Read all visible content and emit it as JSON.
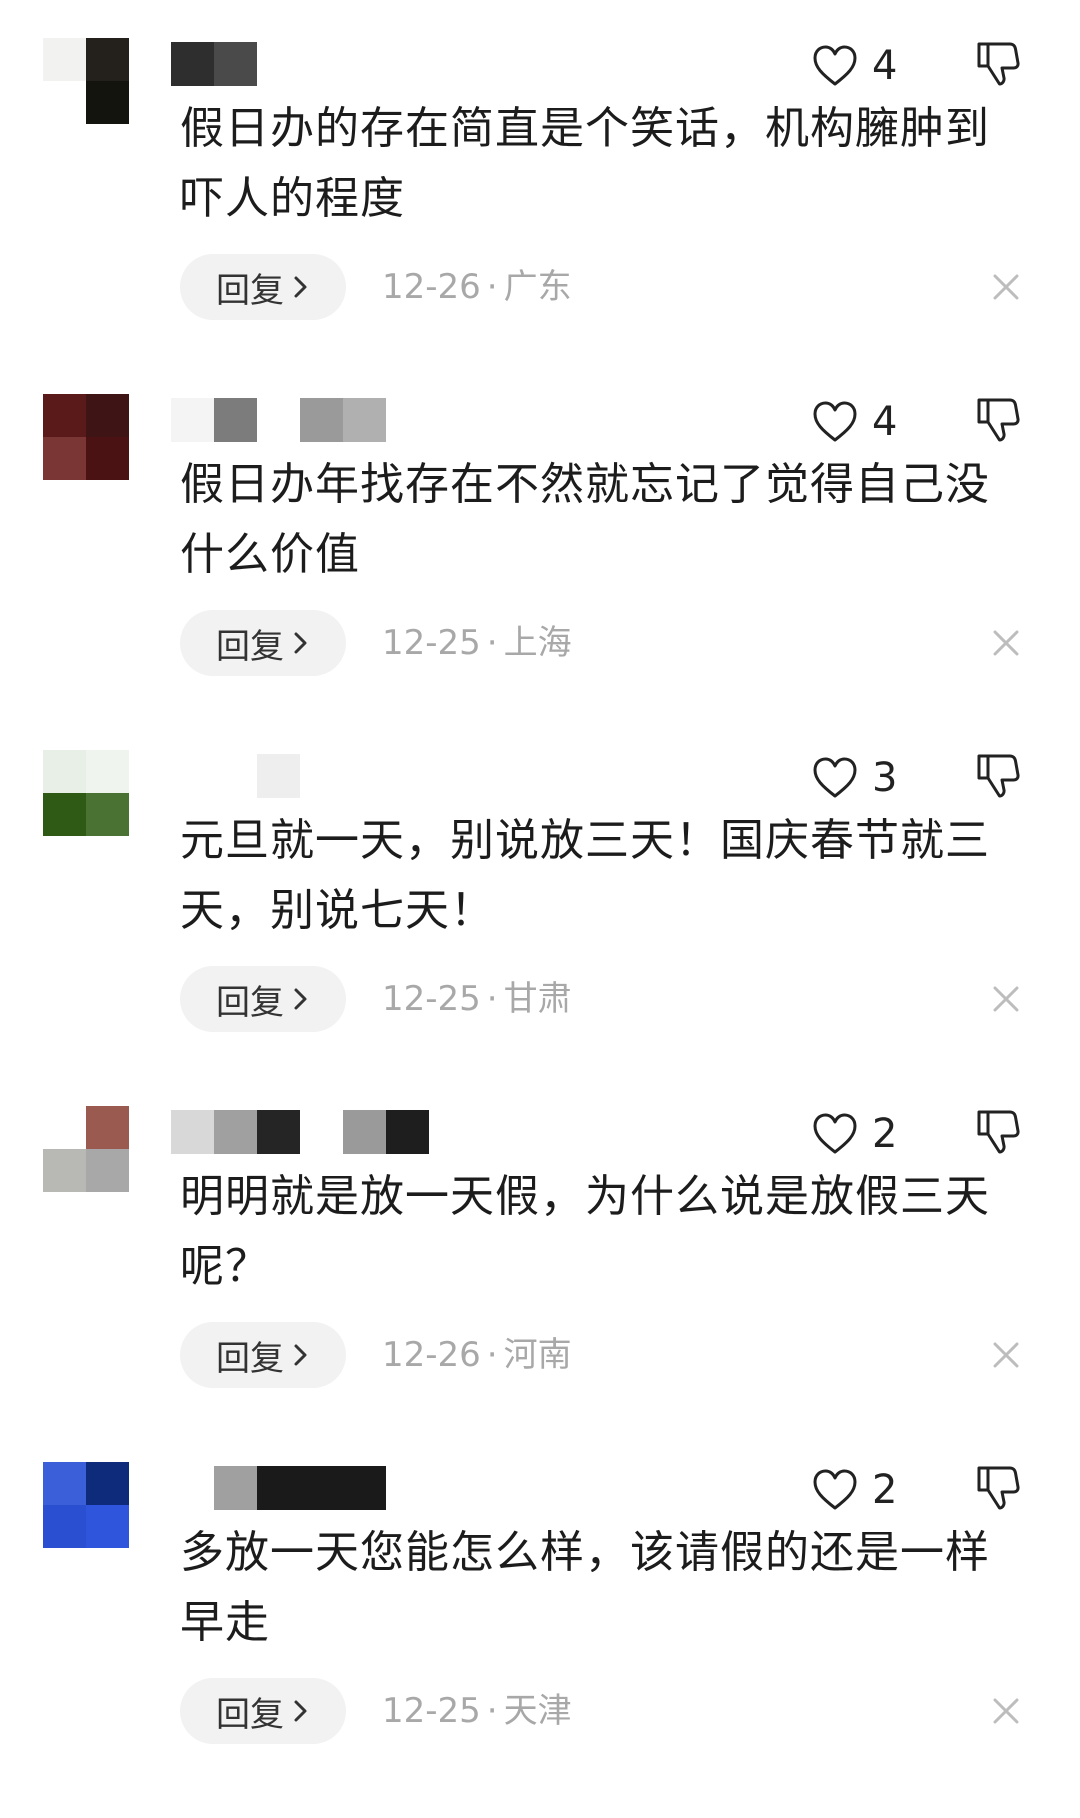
{
  "colors": {
    "text_primary": "#1c1c1c",
    "text_meta": "#a8a8a8",
    "reply_bg": "#f2f2f2",
    "icon_stroke": "#222222",
    "close_stroke": "#bdbdbd"
  },
  "icons": {
    "like": "heart-outline",
    "dislike": "thumb-down-outline",
    "reply_chevron": "chevron-right",
    "dismiss": "close-x"
  },
  "comments": [
    {
      "likes": "4",
      "text": "假日办的存在简直是个笑话，机构臃肿到吓人的程度",
      "reply_label": "回复",
      "date": "12-26",
      "separator": "·",
      "location": "广东",
      "avatar_colors": [
        "#f2f2f0",
        "#24201c",
        "#ffffff",
        "#14140f"
      ],
      "username_colors": [
        "#2e2e2e",
        "#4a4a4a"
      ]
    },
    {
      "likes": "4",
      "text": "假日办年找存在不然就忘记了觉得自己没什么价值",
      "reply_label": "回复",
      "date": "12-25",
      "separator": "·",
      "location": "上海",
      "avatar_colors": [
        "#5a1a1a",
        "#3e1414",
        "#7a3535",
        "#4a1212"
      ],
      "username_colors": [
        "#f4f4f4",
        "#7c7c7c",
        "#ffffff",
        "#9a9a9a",
        "#b0b0b0"
      ]
    },
    {
      "likes": "3",
      "text": "元旦就一天，别说放三天！国庆春节就三天，别说七天！",
      "reply_label": "回复",
      "date": "12-25",
      "separator": "·",
      "location": "甘肃",
      "avatar_colors": [
        "#e8efe6",
        "#f0f4ee",
        "#2e5a16",
        "#4a7232"
      ],
      "username_colors": [
        "#ffffff",
        "#ffffff",
        "#eeeeee"
      ]
    },
    {
      "likes": "2",
      "text": "明明就是放一天假，为什么说是放假三天呢？",
      "reply_label": "回复",
      "date": "12-26",
      "separator": "·",
      "location": "河南",
      "avatar_colors": [
        "#ffffff",
        "#9a5a50",
        "#b8b8b4",
        "#a8a8a8"
      ],
      "username_colors": [
        "#d8d8d8",
        "#a0a0a0",
        "#252525",
        "#ffffff",
        "#9a9a9a",
        "#1e1e1e"
      ]
    },
    {
      "likes": "2",
      "text": "多放一天您能怎么样，该请假的还是一样早走",
      "reply_label": "回复",
      "date": "12-25",
      "separator": "·",
      "location": "天津",
      "avatar_colors": [
        "#3a5fd8",
        "#0e2a7a",
        "#2a4fd0",
        "#2e55dc"
      ],
      "username_colors": [
        "#ffffff",
        "#a0a0a0",
        "#1a1a1a",
        "#1a1a1a",
        "#1a1a1a"
      ]
    }
  ]
}
